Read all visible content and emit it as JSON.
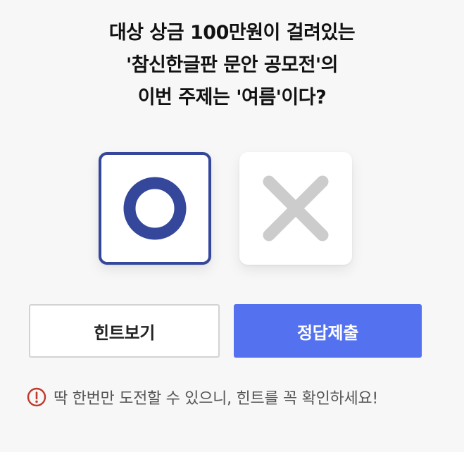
{
  "question": {
    "lines": [
      "대상 상금 100만원이 걸려있는",
      "'참신한글판 문안 공모전'의",
      "이번 주제는 '여름'이다?"
    ]
  },
  "choices": {
    "o": {
      "icon": "circle-o-icon",
      "selected": true,
      "color": "#34479b"
    },
    "x": {
      "icon": "x-mark-icon",
      "selected": false,
      "color": "#cccccc"
    }
  },
  "buttons": {
    "hint_label": "힌트보기",
    "submit_label": "정답제출",
    "submit_color": "#5471f0"
  },
  "notice": {
    "icon": "warning-circle-icon",
    "icon_color": "#c0392b",
    "text": "딱 한번만 도전할 수 있으니, 힌트를 꼭 확인하세요!"
  }
}
